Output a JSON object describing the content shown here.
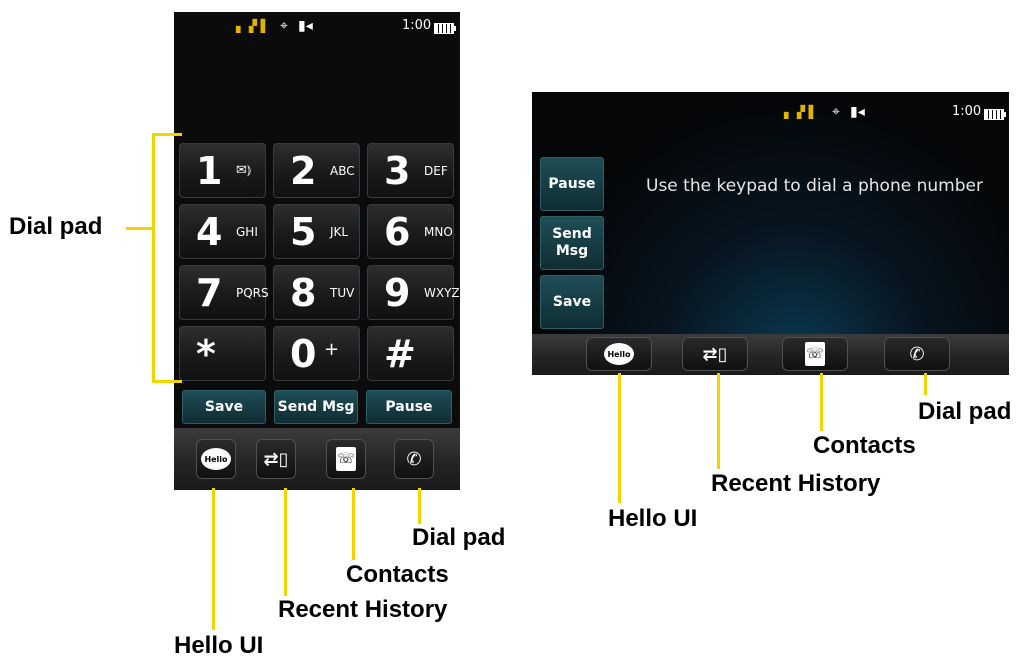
{
  "portrait": {
    "status": {
      "time": "1:00"
    },
    "keys": [
      {
        "digit": "1",
        "letters": ""
      },
      {
        "digit": "2",
        "letters": "ABC"
      },
      {
        "digit": "3",
        "letters": "DEF"
      },
      {
        "digit": "4",
        "letters": "GHI"
      },
      {
        "digit": "5",
        "letters": "JKL"
      },
      {
        "digit": "6",
        "letters": "MNO"
      },
      {
        "digit": "7",
        "letters": "PQRS"
      },
      {
        "digit": "8",
        "letters": "TUV"
      },
      {
        "digit": "9",
        "letters": "WXYZ"
      },
      {
        "digit": "*",
        "letters": ""
      },
      {
        "digit": "0",
        "letters": "+"
      },
      {
        "digit": "#",
        "letters": ""
      }
    ],
    "soft_buttons": [
      "Save",
      "Send Msg",
      "Pause"
    ],
    "dock_icon_text": "Hello"
  },
  "landscape": {
    "status": {
      "time": "1:00"
    },
    "side_buttons": [
      "Pause",
      "Send\nMsg",
      "Save"
    ],
    "message": "Use the keypad to dial a phone number",
    "dock_icon_text": "Hello"
  },
  "callouts": {
    "dial_pad": "Dial pad",
    "hello_ui": "Hello UI",
    "recent_history": "Recent History",
    "contacts": "Contacts"
  },
  "icons": [
    "signal-icon",
    "gps-icon",
    "phone-status-icon",
    "battery-icon",
    "voicemail-icon",
    "hello-icon",
    "recent-history-icon",
    "contacts-icon",
    "dial-pad-icon"
  ],
  "colors": {
    "accent": "#f2d500",
    "soft_button": "#1f4d56"
  }
}
